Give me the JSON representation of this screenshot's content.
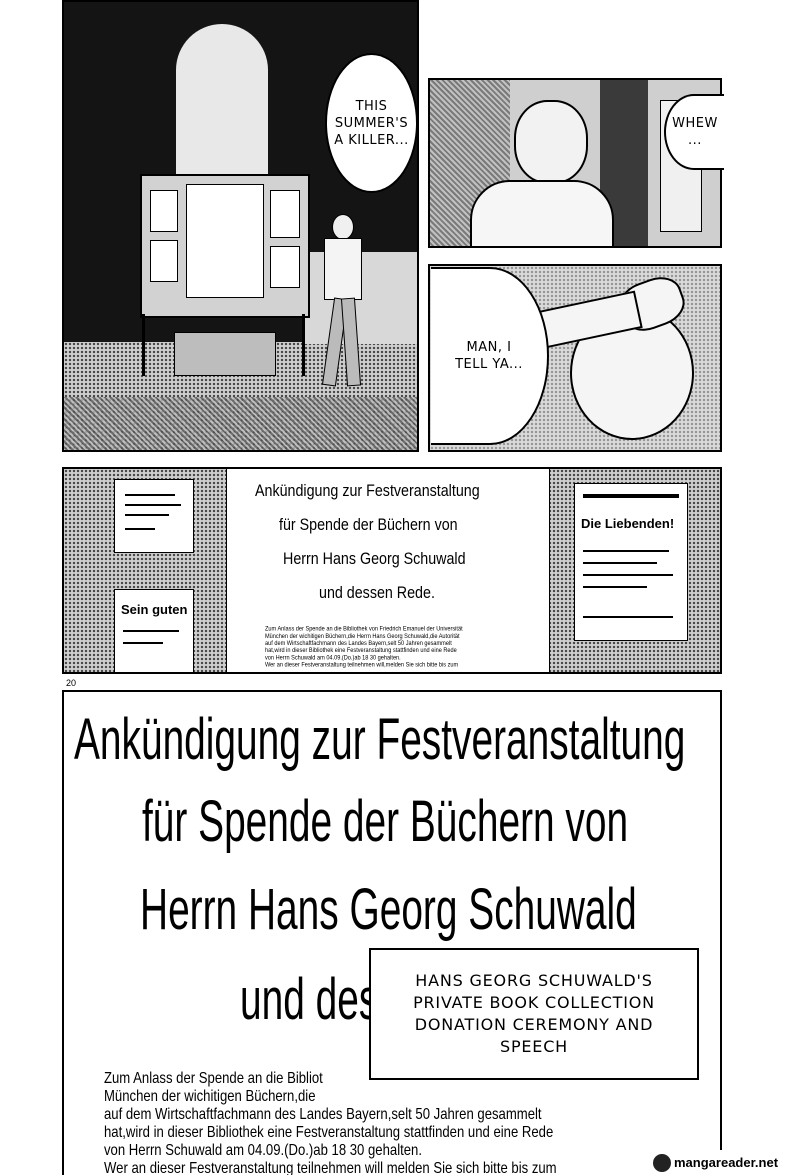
{
  "page_number": "20",
  "watermark": "mangareader.net",
  "panel1": {
    "bubble": "THIS\nSUMMER'S\nA KILLER..."
  },
  "panel2": {
    "bubble": "WHEW\n..."
  },
  "panel3": {
    "bubble": "MAN, I\nTELL YA..."
  },
  "panel4": {
    "title_lines": [
      "Ankündigung zur Festveranstaltung",
      "für Spende der Büchern von",
      "Herrn Hans Georg Schuwald",
      "und dessen Rede."
    ],
    "body_lines": [
      "Zum Anlass der Spende an die Bibliothek von Friedrich Emanuel der Universität",
      "München der wichitigen Büchern,die Herrn Hans Georg Schuwald,die Autorität",
      "auf dem Wirtschaftfachmann des Landes Bayern,selt 50 Jahren gesammelt",
      "hat,wird in dieser Bibliothek eine Festveranstaltung stattfinden und eine Rede",
      "von Herrn Schuwald     am 04.09.(Do.)ab 18 30 gehalten.",
      "Wer an dieser Festveranstaltung teilnehmen will,melden Sie sich bitte bis zum"
    ],
    "left_poster": "Sein guten",
    "right_poster": "Die Liebenden!"
  },
  "panel5": {
    "title_lines": [
      "Ankündigung zur Festveranstaltung",
      "für Spende der Büchern von",
      "Herrn Hans Georg Schuwald",
      "und des"
    ],
    "body_lines": [
      "Zum Anlass der Spende an die Bibliot",
      "München der wichitigen Büchern,die",
      "auf dem Wirtschaftfachmann des Landes Bayern,selt 50 Jahren gesammelt",
      "hat,wird in dieser Bibliothek eine Festveranstaltung stattfinden und eine Rede",
      "von Herrn Schuwald        am 04.09.(Do.)ab 18 30 gehalten.",
      "Wer an dieser Festveranstaltung teilnehmen will melden Sie sich bitte bis zum"
    ],
    "caption": "HANS GEORG SCHUWALD'S\nPRIVATE BOOK COLLECTION\nDONATION CEREMONY AND\nSPEECH"
  }
}
